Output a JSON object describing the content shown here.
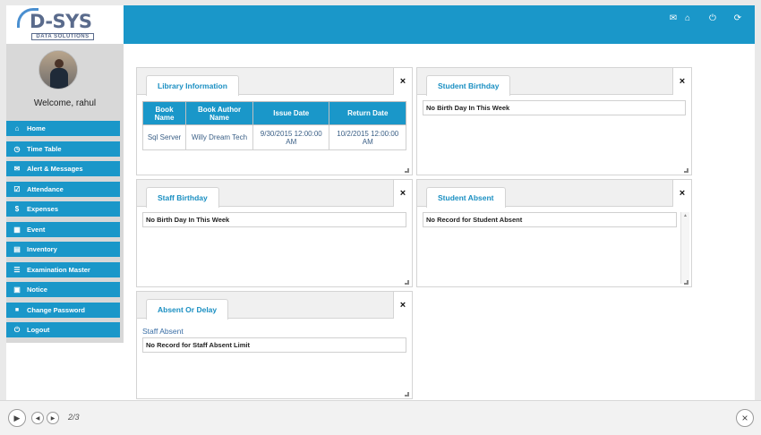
{
  "logo": {
    "name": "D-SYS",
    "tagline": "DATA SOLUTIONS"
  },
  "user": {
    "welcome": "Welcome, rahul"
  },
  "sidebar": {
    "items": [
      {
        "label": "Home",
        "icon": "home-icon",
        "glyph": "⌂"
      },
      {
        "label": "Time Table",
        "icon": "clock-icon",
        "glyph": "◷"
      },
      {
        "label": "Alert & Messages",
        "icon": "envelope-icon",
        "glyph": "✉"
      },
      {
        "label": "Attendance",
        "icon": "checkbox-icon",
        "glyph": "☑"
      },
      {
        "label": "Expenses",
        "icon": "dollar-icon",
        "glyph": "$"
      },
      {
        "label": "Event",
        "icon": "calendar-icon",
        "glyph": "▦"
      },
      {
        "label": "Inventory",
        "icon": "grid-icon",
        "glyph": "▤"
      },
      {
        "label": "Examination Master",
        "icon": "list-icon",
        "glyph": "☰"
      },
      {
        "label": "Notice",
        "icon": "notice-icon",
        "glyph": "▣"
      },
      {
        "label": "Change Password",
        "icon": "lock-icon",
        "glyph": "🔒"
      },
      {
        "label": "Logout",
        "icon": "power-icon",
        "glyph": "⏻"
      }
    ]
  },
  "header": {
    "icons": [
      {
        "name": "mail-icon",
        "glyph": "✉"
      },
      {
        "name": "home-icon",
        "glyph": "⌂"
      },
      {
        "name": "power-icon",
        "glyph": "⏻"
      },
      {
        "name": "refresh-icon",
        "glyph": "⟳"
      }
    ]
  },
  "widgets": {
    "library": {
      "title": "Library Information",
      "close": "×",
      "columns": [
        "Book Name",
        "Book Author Name",
        "Issue Date",
        "Return Date"
      ],
      "rows": [
        [
          "Sql Server",
          "Willy Dream Tech",
          "9/30/2015 12:00:00 AM",
          "10/2/2015 12:00:00 AM"
        ]
      ]
    },
    "student_birthday": {
      "title": "Student Birthday",
      "close": "×",
      "message": "No Birth Day In This Week"
    },
    "staff_birthday": {
      "title": "Staff Birthday",
      "close": "×",
      "message": "No Birth Day In This Week"
    },
    "student_absent": {
      "title": "Student Absent",
      "close": "×",
      "message": "No Record for Student Absent"
    },
    "absent_delay": {
      "title": "Absent Or Delay",
      "close": "×",
      "sub_label": "Staff Absent",
      "message": "No Record for Staff Absent Limit"
    }
  },
  "player": {
    "page": "2/3",
    "close": "×"
  },
  "colors": {
    "accent": "#1a97c9",
    "sidebar_bg": "#d8d8d8",
    "link": "#3a6ea5"
  }
}
